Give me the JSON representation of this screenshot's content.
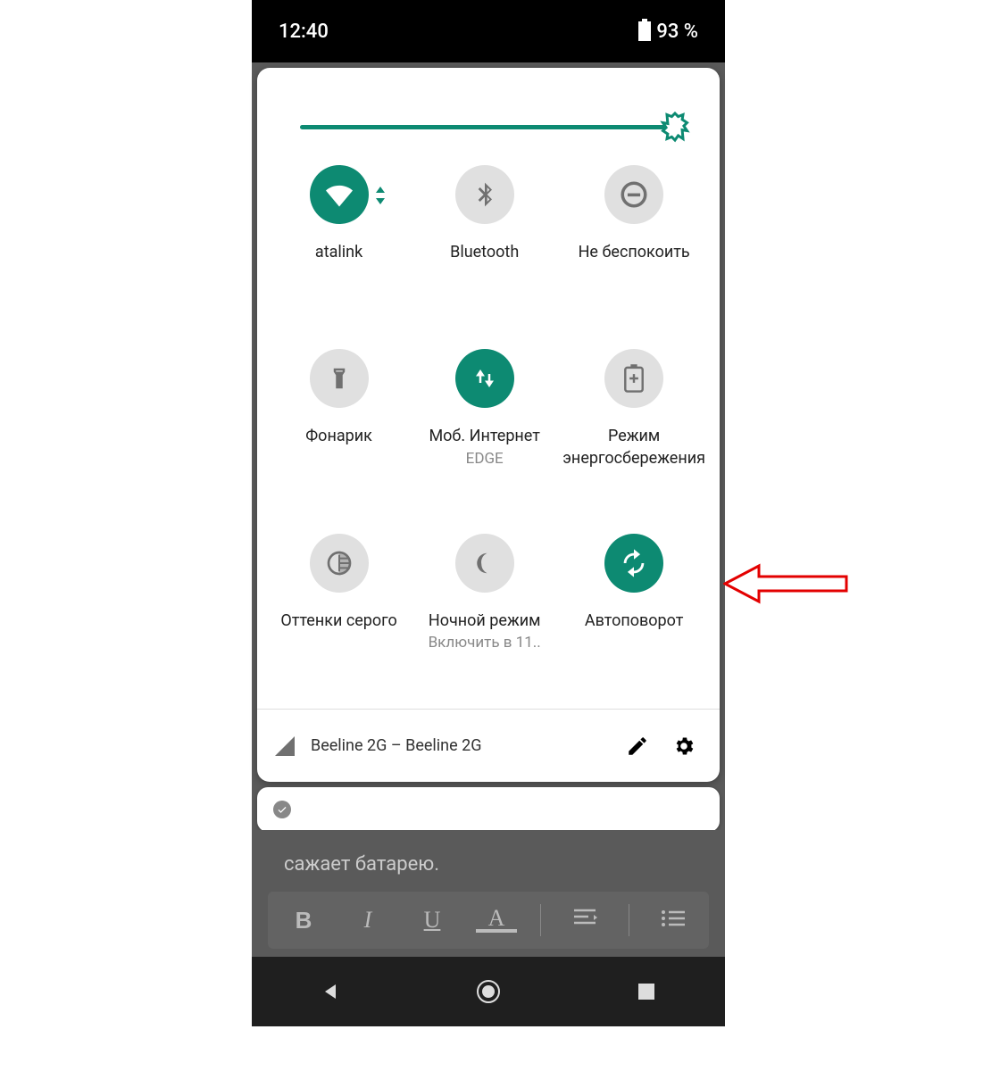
{
  "statusbar": {
    "time": "12:40",
    "battery": "93 %"
  },
  "brightness": {
    "value": 100
  },
  "tiles": {
    "wifi": {
      "label": "atalink",
      "active": true
    },
    "bluetooth": {
      "label": "Bluetooth",
      "active": false
    },
    "dnd": {
      "label": "Не беспокоить",
      "active": false
    },
    "flashlight": {
      "label": "Фонарик",
      "active": false
    },
    "mobiledata": {
      "label": "Моб. Интернет",
      "sublabel": "EDGE",
      "active": true
    },
    "battery_saver": {
      "label": "Режим энергосбережения",
      "active": false
    },
    "grayscale": {
      "label": "Оттенки серого",
      "active": false
    },
    "night": {
      "label": "Ночной режим",
      "sublabel": "Включить в 11..",
      "active": false
    },
    "autorotate": {
      "label": "Автоповорот",
      "active": true
    }
  },
  "footer": {
    "carrier": "Beeline 2G – Beeline 2G"
  },
  "background": {
    "text_fragment": "сажает батарею."
  },
  "toolbar": {
    "bold": "B",
    "italic": "I",
    "underline": "U",
    "color": "A"
  }
}
